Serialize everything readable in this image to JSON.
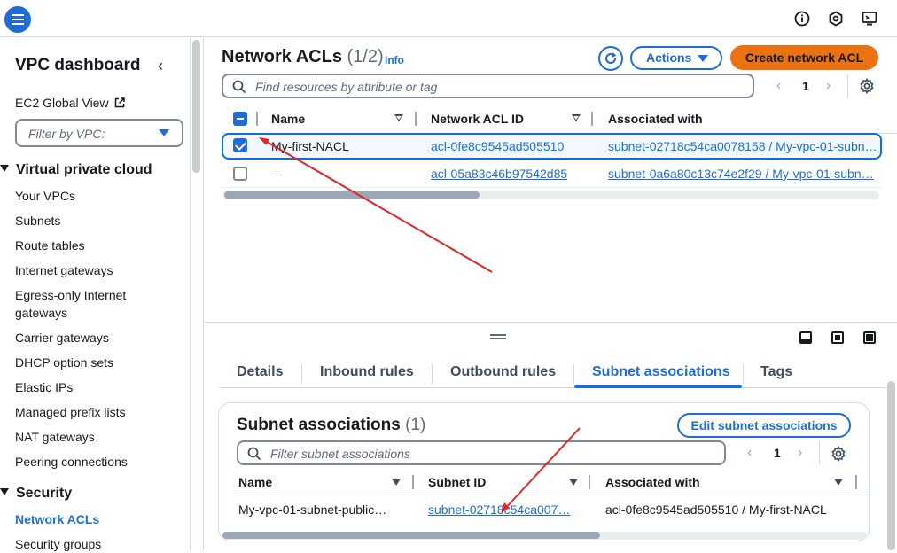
{
  "sidebar": {
    "title": "VPC dashboard",
    "ec2_global_view": "EC2 Global View",
    "vpc_filter_placeholder": "Filter by VPC:",
    "section_vpc": "Virtual private cloud",
    "vpc_items": [
      "Your VPCs",
      "Subnets",
      "Route tables",
      "Internet gateways",
      "Egress-only Internet gateways",
      "Carrier gateways",
      "DHCP option sets",
      "Elastic IPs",
      "Managed prefix lists",
      "NAT gateways",
      "Peering connections"
    ],
    "section_security": "Security",
    "security_items": [
      "Network ACLs",
      "Security groups"
    ],
    "active_item": "Network ACLs"
  },
  "main": {
    "title": "Network ACLs",
    "count": "(1/2)",
    "info_label": "Info",
    "actions_label": "Actions",
    "create_label": "Create network ACL",
    "search_placeholder": "Find resources by attribute or tag",
    "page": "1",
    "columns": [
      "Name",
      "Network ACL ID",
      "Associated with"
    ],
    "rows": [
      {
        "selected": true,
        "name": "My-first-NACL",
        "acl_id": "acl-0fe8c9545ad505510",
        "associated": "subnet-02718c54ca0078158 / My-vpc-01-subn…"
      },
      {
        "selected": false,
        "name": "–",
        "acl_id": "acl-05a83c46b97542d85",
        "associated": "subnet-0a6a80c13c74e2f29 / My-vpc-01-subn…"
      }
    ]
  },
  "details": {
    "tabs": [
      "Details",
      "Inbound rules",
      "Outbound rules",
      "Subnet associations",
      "Tags"
    ],
    "active_tab": "Subnet associations",
    "title": "Subnet associations",
    "count": "(1)",
    "edit_label": "Edit subnet associations",
    "filter_placeholder": "Filter subnet associations",
    "page": "1",
    "columns": [
      "Name",
      "Subnet ID",
      "Associated with"
    ],
    "rows": [
      {
        "name": "My-vpc-01-subnet-public…",
        "subnet_id": "subnet-02718c54ca007…",
        "associated": "acl-0fe8c9545ad505510 / My-first-NACL"
      }
    ]
  },
  "colors": {
    "accent": "#1f6cd8",
    "primary_button": "#ec7211",
    "annotation_arrow": "#e0262b"
  }
}
